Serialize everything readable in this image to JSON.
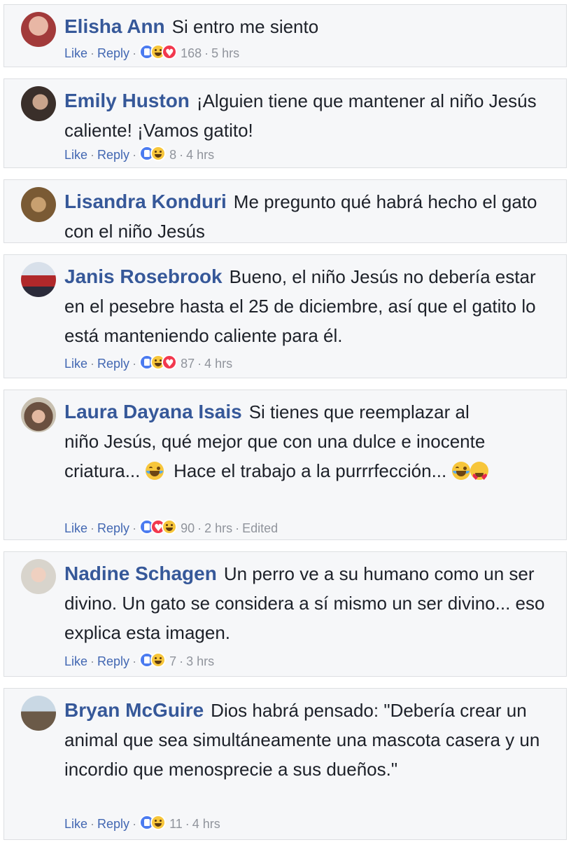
{
  "labels": {
    "like": "Like",
    "reply": "Reply",
    "sep": "·"
  },
  "colors": {
    "name": "#365899",
    "link": "#4267b2",
    "meta": "#90949c",
    "text": "#1d2129",
    "card_bg": "#f6f7f9",
    "card_border": "#dddfe2"
  },
  "comments": [
    {
      "author": "Elisha Ann",
      "text": "Si entro me siento",
      "reactions": [
        "like",
        "haha",
        "love"
      ],
      "reaction_count": "168",
      "time": "5 hrs"
    },
    {
      "author": "Emily Huston",
      "text": "¡Alguien tiene que mantener al niño Jesús caliente! ¡Vamos gatito!",
      "reactions": [
        "like",
        "haha"
      ],
      "reaction_count": "8",
      "time": "4 hrs"
    },
    {
      "author": "Lisandra Konduri",
      "text": "Me pregunto qué habrá hecho el gato con el niño Jesús"
    },
    {
      "author": "Janis Rosebrook",
      "text": "Bueno, el niño Jesús no debería estar en el pesebre hasta el 25 de diciembre, así que el gatito lo está manteniendo caliente para él.",
      "reactions": [
        "like",
        "haha",
        "love"
      ],
      "reaction_count": "87",
      "time": "4 hrs"
    },
    {
      "author": "Laura Dayana Isais",
      "text_a": "Si tienes que reemplazar al niño Jesús, qué mejor que con una dulce e inocente criatura...",
      "text_b": "Hace el trabajo a la purrrfección...",
      "emoji_1": "face-with-tears-of-joy",
      "emoji_2": "face-with-tears-of-joy",
      "emoji_3": "smiling-face-with-heart-eyes",
      "reactions": [
        "like",
        "love",
        "haha"
      ],
      "reaction_count": "90",
      "time": "2 hrs",
      "edited": "Edited"
    },
    {
      "author": "Nadine Schagen",
      "text": "Un perro ve a su humano como un ser divino. Un gato se considera a sí mismo un ser divino... eso explica esta imagen.",
      "reactions": [
        "like",
        "haha"
      ],
      "reaction_count": "7",
      "time": "3 hrs"
    },
    {
      "author": "Bryan McGuire",
      "text": "Dios habrá pensado: \"Debería crear un animal que sea simultáneamente una mascota casera y un incordio que menosprecie a sus dueños.\"",
      "reactions": [
        "like",
        "haha"
      ],
      "reaction_count": "11",
      "time": "4 hrs"
    }
  ]
}
